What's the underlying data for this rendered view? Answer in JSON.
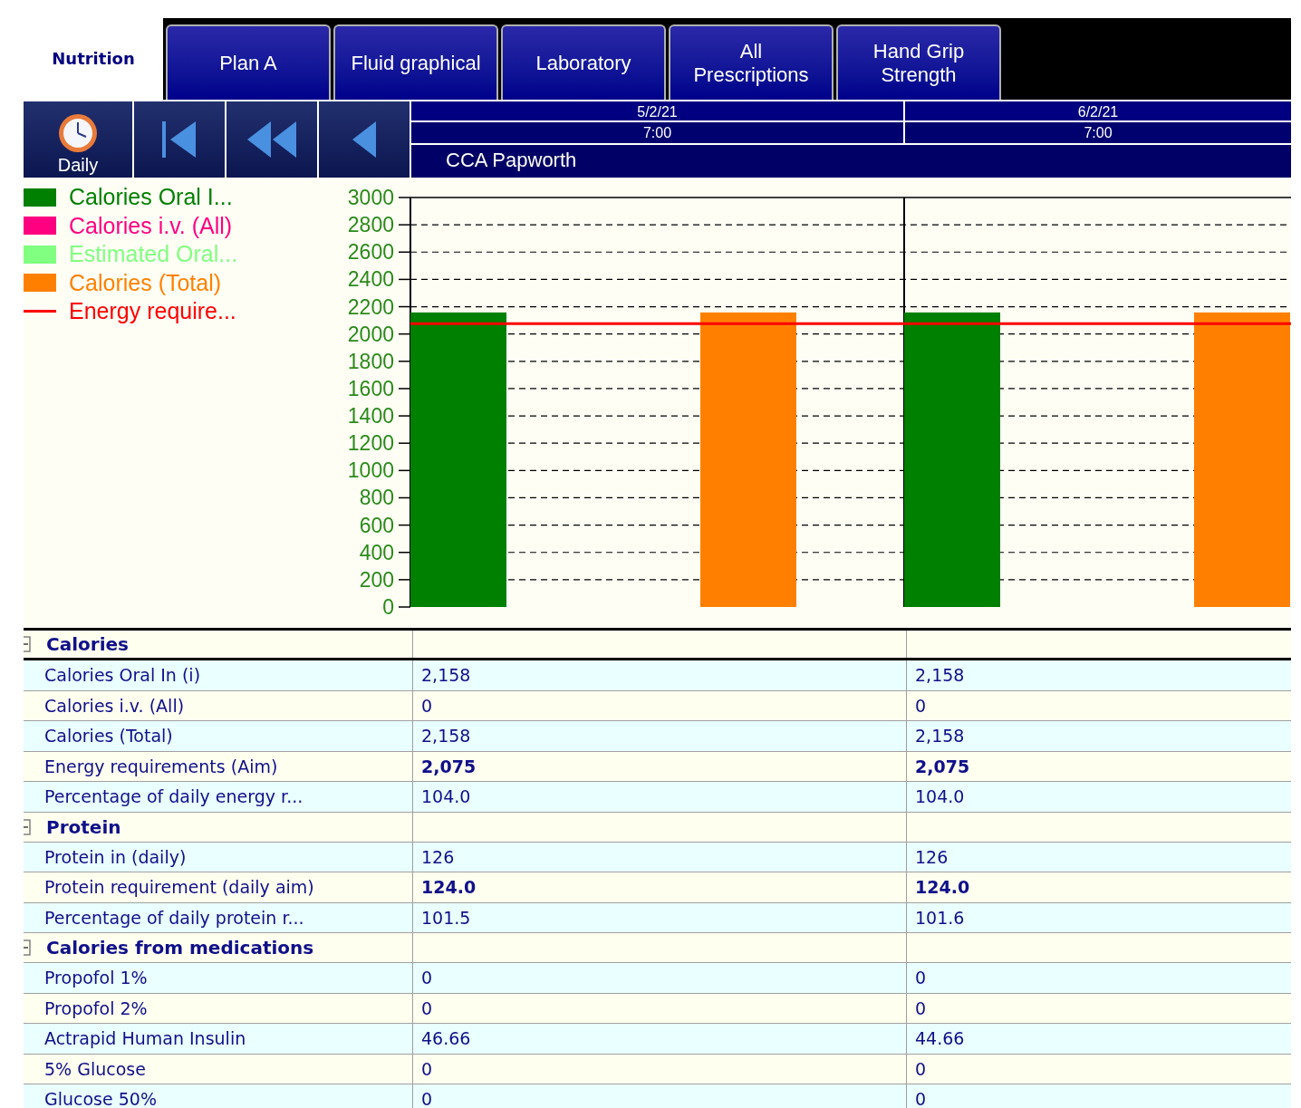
{
  "tabs": [
    {
      "label": "Nutrition",
      "selected": true
    },
    {
      "label": "Plan A",
      "selected": false
    },
    {
      "label": "Fluid graphical",
      "selected": false
    },
    {
      "label": "Laboratory",
      "selected": false
    },
    {
      "label": "All\nPrescriptions",
      "selected": false
    },
    {
      "label": "Hand Grip\nStrength",
      "selected": false
    }
  ],
  "toolbar": {
    "period": "Daily",
    "nav_buttons": [
      {
        "kind": "first"
      },
      {
        "kind": "rewind"
      },
      {
        "kind": "back"
      }
    ]
  },
  "columns": [
    {
      "date": "5/2/21",
      "time": "7:00"
    },
    {
      "date": "6/2/21",
      "time": "7:00"
    }
  ],
  "location": "CCA Papworth",
  "chart": {
    "chart_data": {
      "type": "bar",
      "stacked": false,
      "grid": true,
      "ylim": [
        0,
        3000
      ],
      "yticks": [
        0,
        200,
        400,
        600,
        800,
        1000,
        1200,
        1400,
        1600,
        1800,
        2000,
        2200,
        2400,
        2600,
        2800,
        3000
      ],
      "series": [
        {
          "name": "Calories Oral I...",
          "color": "#008000",
          "values": [
            2158,
            2158
          ]
        },
        {
          "name": "Calories i.v. (All)",
          "color": "#ff0080",
          "values": [
            0,
            0
          ]
        },
        {
          "name": "Estimated Oral...",
          "color": "#80ff80",
          "values": [
            null,
            null
          ]
        },
        {
          "name": "Calories (Total)",
          "color": "#ff8000",
          "values": [
            2158,
            2158
          ]
        }
      ],
      "ref_lines": [
        {
          "axis": "y",
          "value": 2075,
          "label": "Energy require...",
          "color": "#ff0000"
        }
      ]
    }
  },
  "table": {
    "groups": [
      {
        "title": "Calories",
        "expanded": true,
        "rows": [
          {
            "label": "Calories Oral In (i)",
            "values": [
              "2,158",
              "2,158"
            ],
            "bold": false
          },
          {
            "label": "Calories i.v. (All)",
            "values": [
              "0",
              "0"
            ],
            "bold": false
          },
          {
            "label": "Calories (Total)",
            "values": [
              "2,158",
              "2,158"
            ],
            "bold": false
          },
          {
            "label": "Energy requirements (Aim)",
            "values": [
              "2,075",
              "2,075"
            ],
            "bold": true
          },
          {
            "label": "Percentage of daily energy r...",
            "values": [
              "104.0",
              "104.0"
            ],
            "bold": false
          }
        ]
      },
      {
        "title": "Protein",
        "expanded": true,
        "rows": [
          {
            "label": "Protein in (daily)",
            "values": [
              "126",
              "126"
            ],
            "bold": false
          },
          {
            "label": "Protein requirement (daily aim)",
            "values": [
              "124.0",
              "124.0"
            ],
            "bold": true
          },
          {
            "label": "Percentage of daily protein r...",
            "values": [
              "101.5",
              "101.6"
            ],
            "bold": false
          }
        ]
      },
      {
        "title": "Calories from medications",
        "expanded": true,
        "rows": [
          {
            "label": "Propofol 1%",
            "values": [
              "0",
              "0"
            ],
            "bold": false
          },
          {
            "label": "Propofol 2%",
            "values": [
              "0",
              "0"
            ],
            "bold": false
          },
          {
            "label": "Actrapid Human Insulin",
            "values": [
              "46.66",
              "44.66"
            ],
            "bold": false
          },
          {
            "label": "5% Glucose",
            "values": [
              "0",
              "0"
            ],
            "bold": false
          },
          {
            "label": "Glucose 50%",
            "values": [
              "0",
              "0"
            ],
            "bold": false
          }
        ]
      }
    ]
  }
}
